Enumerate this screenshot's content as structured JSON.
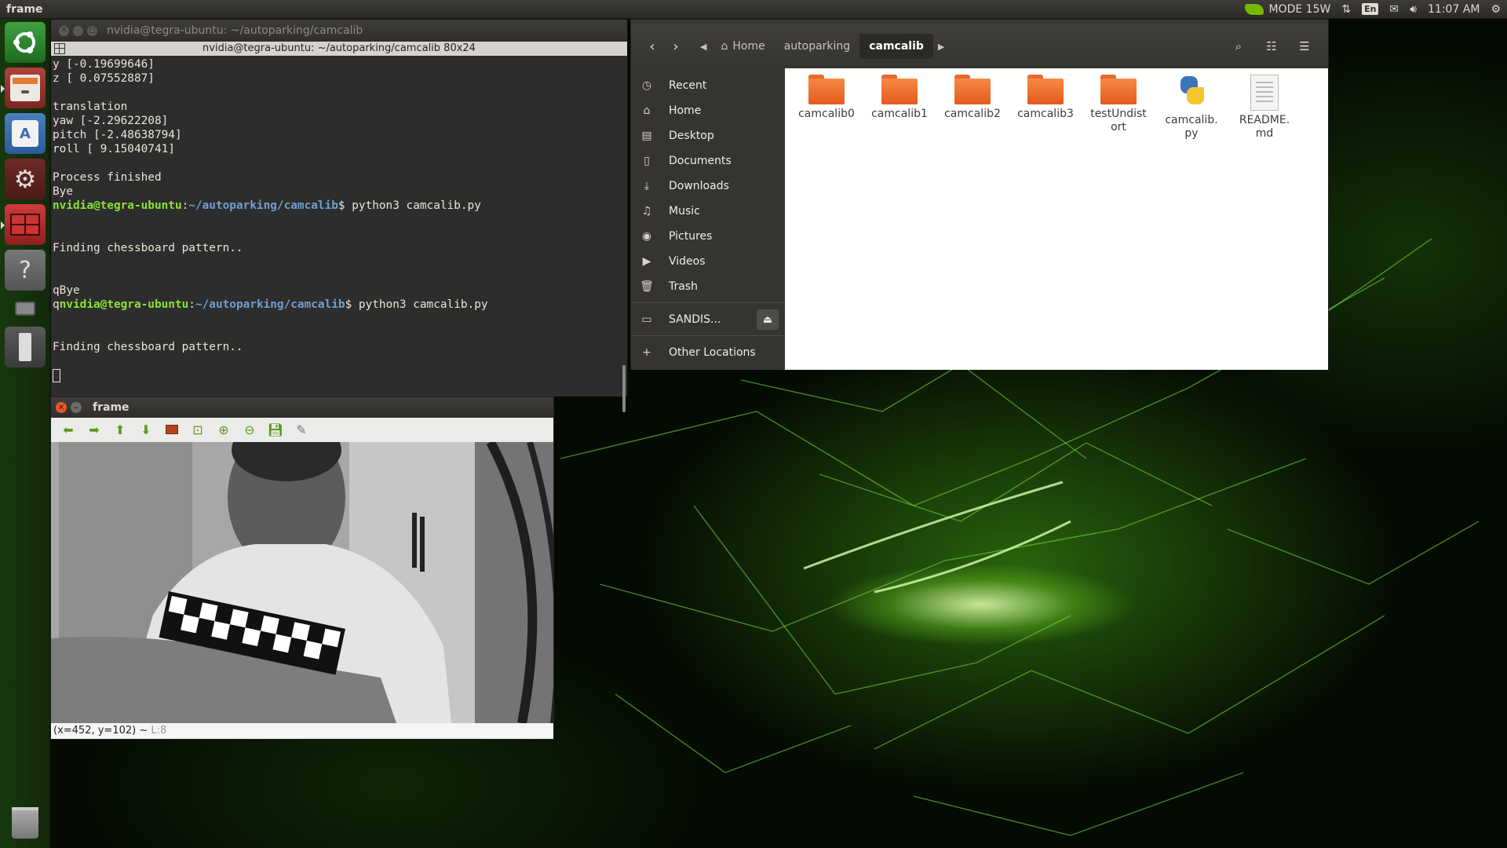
{
  "top_panel": {
    "app_title": "frame",
    "mode": "MODE 15W",
    "language": "En",
    "time": "11:07 AM"
  },
  "launcher": {
    "items": [
      "ubuntu-dash-icon",
      "files-icon",
      "software-center-icon",
      "system-settings-icon",
      "workspace-switcher-icon",
      "help-icon",
      "camera-icon",
      "usb-drive-icon",
      "trash-icon"
    ]
  },
  "terminal": {
    "title": "nvidia@tegra-ubuntu: ~/autoparking/camcalib",
    "tab_title": "nvidia@tegra-ubuntu: ~/autoparking/camcalib 80x24",
    "lines": [
      {
        "text": "y [-0.19699646]"
      },
      {
        "text": "z [ 0.07552887]"
      },
      {
        "text": ""
      },
      {
        "text": "translation"
      },
      {
        "text": "yaw [-2.29622208]"
      },
      {
        "text": "pitch [-2.48638794]"
      },
      {
        "text": "roll [ 9.15040741]"
      },
      {
        "text": ""
      },
      {
        "text": "Process finished"
      },
      {
        "text": "Bye"
      },
      {
        "prefix": "",
        "user": "nvidia@tegra-ubuntu",
        "path": "~/autoparking/camcalib",
        "cmd": " python3 camcalib.py"
      },
      {
        "text": ""
      },
      {
        "text": ""
      },
      {
        "text": "Finding chessboard pattern.."
      },
      {
        "text": ""
      },
      {
        "text": ""
      },
      {
        "text": "qBye"
      },
      {
        "prefix": "q",
        "user": "nvidia@tegra-ubuntu",
        "path": "~/autoparking/camcalib",
        "cmd": " python3 camcalib.py"
      },
      {
        "text": ""
      },
      {
        "text": ""
      },
      {
        "text": "Finding chessboard pattern.."
      }
    ]
  },
  "files": {
    "nav": {
      "back": "back-icon",
      "forward": "forward-icon"
    },
    "breadcrumbs": [
      {
        "label": "Home",
        "icon": "home-icon"
      },
      {
        "label": "autoparking"
      },
      {
        "label": "camcalib",
        "active": true
      }
    ],
    "sidebar": [
      {
        "label": "Recent",
        "icon": "clock-icon"
      },
      {
        "label": "Home",
        "icon": "home-icon"
      },
      {
        "label": "Desktop",
        "icon": "desktop-icon"
      },
      {
        "label": "Documents",
        "icon": "document-icon"
      },
      {
        "label": "Downloads",
        "icon": "download-icon"
      },
      {
        "label": "Music",
        "icon": "music-icon"
      },
      {
        "label": "Pictures",
        "icon": "camera-icon"
      },
      {
        "label": "Videos",
        "icon": "video-icon"
      },
      {
        "label": "Trash",
        "icon": "trash-icon"
      },
      {
        "label": "SANDIS...",
        "icon": "drive-icon"
      },
      {
        "label": "Other Locations",
        "icon": "plus-icon"
      }
    ],
    "items": [
      {
        "name": "camcalib0",
        "type": "folder"
      },
      {
        "name": "camcalib1",
        "type": "folder"
      },
      {
        "name": "camcalib2",
        "type": "folder"
      },
      {
        "name": "camcalib3",
        "type": "folder"
      },
      {
        "name": "testUndist\nort",
        "type": "folder"
      },
      {
        "name": "camcalib.\npy",
        "type": "python"
      },
      {
        "name": "README.\nmd",
        "type": "text"
      }
    ]
  },
  "frame_window": {
    "title": "frame",
    "status_coords": "(x=452, y=102) ~",
    "status_value": " L:8"
  },
  "colors": {
    "terminal_bg": "#2d2d2d",
    "prompt_user": "#8ae234",
    "prompt_path": "#729fcf",
    "nvidia_green": "#76b900",
    "folder_orange": "#f0762f"
  }
}
